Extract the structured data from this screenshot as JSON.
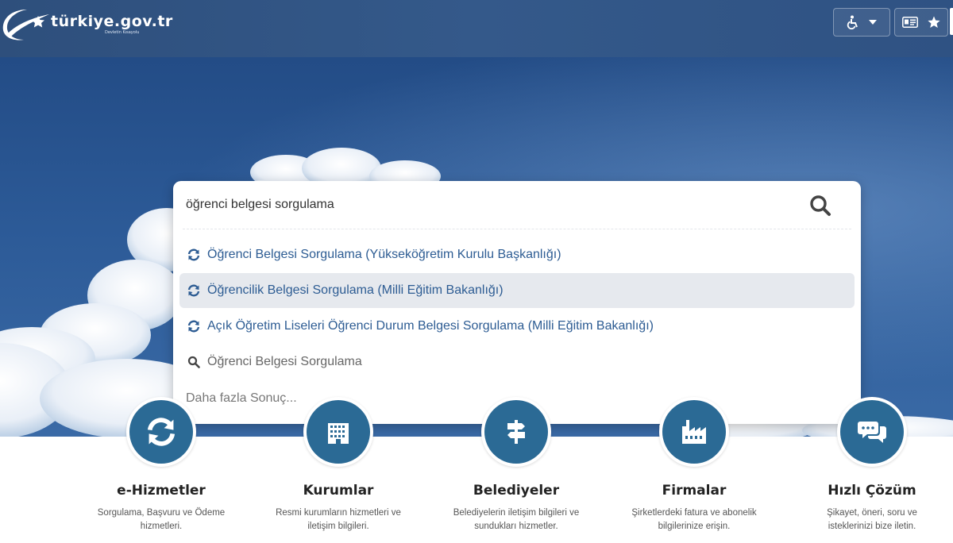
{
  "header": {
    "logo_text": "türkiye.gov.tr",
    "logo_tagline": "Devletin Kısayolu",
    "accessibility_icon": "wheelchair-icon",
    "id_icon": "id-card-icon",
    "favorites_icon": "star-icon"
  },
  "search": {
    "value": "öğrenci belgesi sorgulama",
    "icon": "search-icon",
    "results": [
      {
        "label": "Öğrenci Belgesi Sorgulama (Yükseköğretim Kurulu Başkanlığı)",
        "icon": "service-refresh-icon"
      },
      {
        "label": "Öğrencilik Belgesi Sorgulama (Milli Eğitim Bakanlığı)",
        "icon": "service-refresh-icon"
      },
      {
        "label": "Açık Öğretim Liseleri Öğrenci Durum Belgesi Sorgulama (Milli Eğitim Bakanlığı)",
        "icon": "service-refresh-icon"
      },
      {
        "label": "Öğrenci Belgesi Sorgulama",
        "icon": "search-icon"
      }
    ],
    "more": "Daha fazla Sonuç..."
  },
  "categories": [
    {
      "title": "e-Hizmetler",
      "desc1": "Sorgulama, Başvuru ve Ödeme",
      "desc2": "hizmetleri.",
      "icon": "refresh-icon"
    },
    {
      "title": "Kurumlar",
      "desc1": "Resmi kurumların hizmetleri ve",
      "desc2": "iletişim bilgileri.",
      "icon": "building-icon"
    },
    {
      "title": "Belediyeler",
      "desc1": "Belediyelerin iletişim bilgileri ve",
      "desc2": "sundukları hizmetler.",
      "icon": "signpost-icon"
    },
    {
      "title": "Firmalar",
      "desc1": "Şirketlerdeki fatura ve abonelik",
      "desc2": "bilgilerinize erişin.",
      "icon": "factory-icon"
    },
    {
      "title": "Hızlı Çözüm",
      "desc1": "Şikayet, öneri, soru ve",
      "desc2": "isteklerinizi bize iletin.",
      "icon": "chat-bubbles-icon"
    }
  ],
  "colors": {
    "header_bg": "#2e4f7c",
    "link_blue": "#2d5c93",
    "category_circle": "#2b6a95",
    "active_row": "#e6e9ee"
  }
}
